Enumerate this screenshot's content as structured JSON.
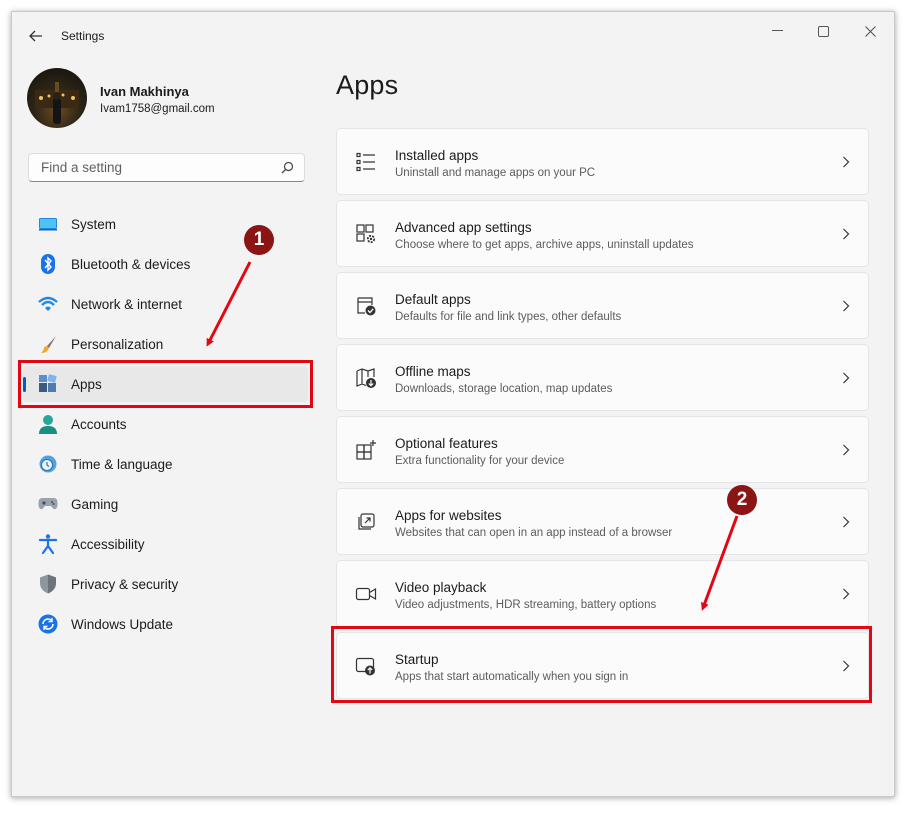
{
  "window": {
    "title": "Settings"
  },
  "profile": {
    "name": "Ivan Makhinya",
    "email": "Ivam1758@gmail.com"
  },
  "search": {
    "placeholder": "Find a setting"
  },
  "nav": {
    "items": [
      {
        "label": "System",
        "icon": "system-icon"
      },
      {
        "label": "Bluetooth & devices",
        "icon": "bluetooth-icon"
      },
      {
        "label": "Network & internet",
        "icon": "wifi-icon"
      },
      {
        "label": "Personalization",
        "icon": "brush-icon"
      },
      {
        "label": "Apps",
        "icon": "apps-icon",
        "selected": true
      },
      {
        "label": "Accounts",
        "icon": "accounts-icon"
      },
      {
        "label": "Time & language",
        "icon": "clock-globe-icon"
      },
      {
        "label": "Gaming",
        "icon": "gamepad-icon"
      },
      {
        "label": "Accessibility",
        "icon": "accessibility-icon"
      },
      {
        "label": "Privacy & security",
        "icon": "shield-icon"
      },
      {
        "label": "Windows Update",
        "icon": "update-icon"
      }
    ]
  },
  "main": {
    "title": "Apps",
    "cards": [
      {
        "title": "Installed apps",
        "subtitle": "Uninstall and manage apps on your PC",
        "icon": "list-icon"
      },
      {
        "title": "Advanced app settings",
        "subtitle": "Choose where to get apps, archive apps, uninstall updates",
        "icon": "app-gear-icon"
      },
      {
        "title": "Default apps",
        "subtitle": "Defaults for file and link types, other defaults",
        "icon": "default-apps-icon"
      },
      {
        "title": "Offline maps",
        "subtitle": "Downloads, storage location, map updates",
        "icon": "map-download-icon"
      },
      {
        "title": "Optional features",
        "subtitle": "Extra functionality for your device",
        "icon": "grid-plus-icon"
      },
      {
        "title": "Apps for websites",
        "subtitle": "Websites that can open in an app instead of a browser",
        "icon": "open-external-icon"
      },
      {
        "title": "Video playback",
        "subtitle": "Video adjustments, HDR streaming, battery options",
        "icon": "video-camera-icon"
      },
      {
        "title": "Startup",
        "subtitle": "Apps that start automatically when you sign in",
        "icon": "startup-icon"
      }
    ]
  },
  "annotations": {
    "step1": "1",
    "step2": "2",
    "color": "#e30613"
  },
  "colors": {
    "accent": "#005fb8",
    "window_bg": "#f3f3f3",
    "card_bg": "#fbfbfb",
    "badge": "#8b1414"
  }
}
